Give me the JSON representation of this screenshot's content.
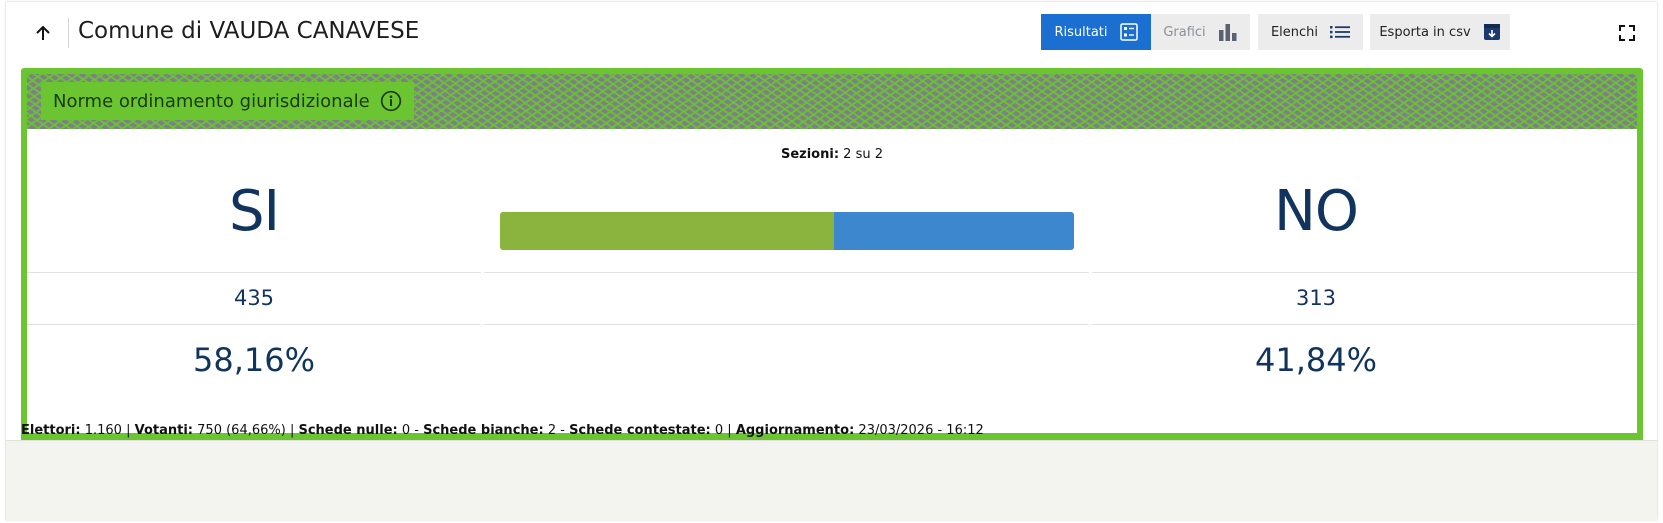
{
  "header": {
    "title": "Comune di VAUDA CANAVESE",
    "buttons": {
      "risultati": "Risultati",
      "grafici": "Grafici",
      "elenchi": "Elenchi",
      "esporta": "Esporta in csv"
    }
  },
  "question": {
    "label": "Norme ordinamento giurisdizionale"
  },
  "sezioni": {
    "label": "Sezioni:",
    "value": "2 su 2"
  },
  "results": {
    "si": {
      "label": "SI",
      "votes": "435",
      "percent": "58,16%",
      "fraction": 0.5816
    },
    "no": {
      "label": "NO",
      "votes": "313",
      "percent": "41,84%",
      "fraction": 0.4184
    }
  },
  "footer": {
    "elettori_label": "Elettori:",
    "elettori_value": "1.160",
    "votanti_label": "Votanti:",
    "votanti_value": "750 (64,66%)",
    "nulle_label": "Schede nulle:",
    "nulle_value": "0",
    "bianche_label": "Schede bianche:",
    "bianche_value": "2",
    "contestate_label": "Schede contestate:",
    "contestate_value": "0",
    "aggiornamento_label": "Aggiornamento:",
    "aggiornamento_value": "23/03/2026 - 16:12"
  },
  "colors": {
    "accent": "#1b6fd1",
    "card_green": "#6ac530",
    "bar_si": "#8bb43e",
    "bar_no": "#3d87cf",
    "result_text": "#10345e"
  },
  "icons": {
    "back": "arrow-up-icon",
    "info": "info-circle-icon",
    "risultati": "list-detail-icon",
    "grafici": "bar-chart-icon",
    "elenchi": "list-icon",
    "esporta": "archive-download-icon",
    "fullscreen": "fullscreen-icon"
  }
}
